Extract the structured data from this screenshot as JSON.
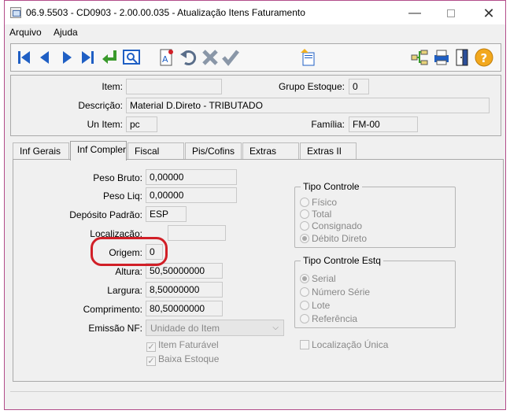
{
  "window": {
    "title": "06.9.5503 - CD0903 - 2.00.00.035 - Atualização Itens Faturamento",
    "minimize": "—",
    "close": "✕"
  },
  "menu": {
    "items": [
      "Arquivo",
      "Ajuda"
    ]
  },
  "toolbar": {
    "buttons": [
      "first-record",
      "previous-record",
      "next-record",
      "last-record",
      "goto",
      "zoom",
      "new-record",
      "undo",
      "cancel",
      "save",
      "copy",
      "hierarchy",
      "print",
      "exit",
      "help"
    ]
  },
  "header": {
    "item_label": "Item:",
    "item_value": "",
    "grupo_label": "Grupo Estoque:",
    "grupo_value": "0",
    "descricao_label": "Descrição:",
    "descricao_value": "Material D.Direto - TRIBUTADO",
    "un_label": "Un Item:",
    "un_value": "pc",
    "familia_label": "Família:",
    "familia_value": "FM-00"
  },
  "tabs": [
    "Inf Gerais",
    "Inf Compler",
    "Fiscal",
    "Pis/Cofins",
    "Extras",
    "Extras II"
  ],
  "active_tab": "Inf Compler",
  "form": {
    "peso_bruto_label": "Peso Bruto:",
    "peso_bruto": "0,00000",
    "peso_liq_label": "Peso Liq:",
    "peso_liq": "0,00000",
    "deposito_label": "Depósito Padrão:",
    "deposito": "ESP",
    "localizacao_label": "Localização:",
    "localizacao": "",
    "origem_label": "Origem:",
    "origem": "0",
    "altura_label": "Altura:",
    "altura": "50,50000000",
    "largura_label": "Largura:",
    "largura": "8,50000000",
    "comprimento_label": "Comprimento:",
    "comprimento": "80,50000000",
    "emissao_label": "Emissão NF:",
    "emissao": "Unidade do Item",
    "item_faturavel": "Item Faturável",
    "baixa_estoque": "Baixa Estoque"
  },
  "tipo_controle": {
    "title": "Tipo Controle",
    "options": [
      "Físico",
      "Total",
      "Consignado",
      "Débito Direto"
    ],
    "selected": 3
  },
  "tipo_controle_estq": {
    "title": "Tipo Controle Estq",
    "options": [
      "Serial",
      "Número Série",
      "Lote",
      "Referência"
    ],
    "selected": 0
  },
  "localizacao_unica": "Localização Única",
  "colors": {
    "highlight": "#d11f27",
    "toolbar_blue": "#1f5fc4",
    "accent_green": "#3a9a2c"
  }
}
